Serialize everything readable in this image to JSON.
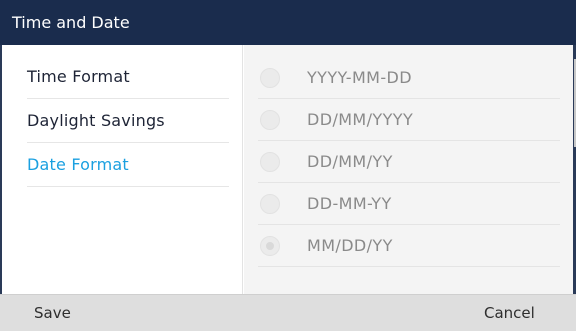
{
  "window": {
    "title": "Time and Date"
  },
  "sidebar": {
    "items": [
      {
        "label": "Time Format",
        "active": false
      },
      {
        "label": "Daylight Savings",
        "active": false
      },
      {
        "label": "Date Format",
        "active": true
      }
    ]
  },
  "options": [
    {
      "label": "YYYY-MM-DD",
      "selected": false
    },
    {
      "label": "DD/MM/YYYY",
      "selected": false
    },
    {
      "label": "DD/MM/YY",
      "selected": false
    },
    {
      "label": "DD-MM-YY",
      "selected": false
    },
    {
      "label": "MM/DD/YY",
      "selected": true
    }
  ],
  "footer": {
    "save_label": "Save",
    "cancel_label": "Cancel"
  },
  "colors": {
    "header_bg": "#1a2c4d",
    "active_item": "#1ba0e0",
    "footer_bg": "#dedede",
    "options_bg": "#f4f4f4"
  }
}
